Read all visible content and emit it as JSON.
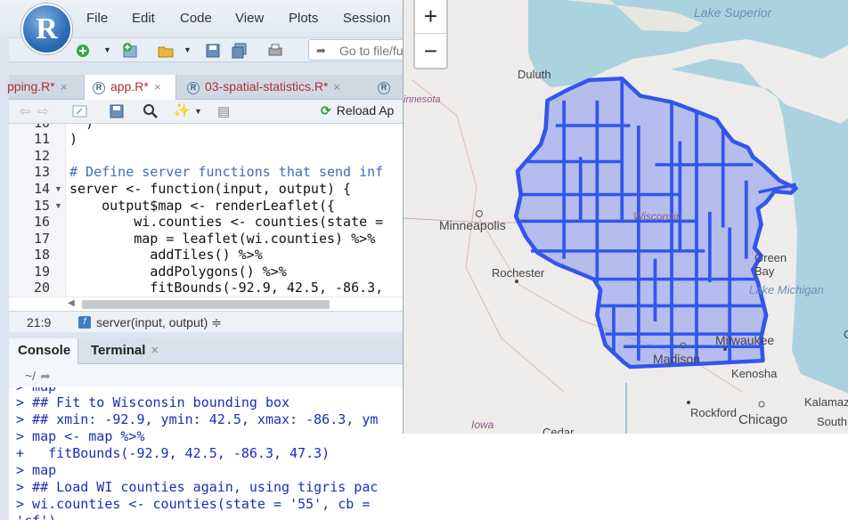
{
  "menu": {
    "logo": "R",
    "items": [
      "File",
      "Edit",
      "Code",
      "View",
      "Plots",
      "Session"
    ]
  },
  "toolbar": {
    "goto_placeholder": "Go to file/fu"
  },
  "editor": {
    "tabs": [
      {
        "label": "pping.R*",
        "active": false
      },
      {
        "label": "app.R*",
        "active": true
      },
      {
        "label": "03-spatial-statistics.R*",
        "active": false
      },
      {
        "label": "",
        "active": false
      }
    ],
    "reload_label": "Reload Ap",
    "lines": [
      {
        "n": "10",
        "text": "  )"
      },
      {
        "n": "11",
        "text": ")"
      },
      {
        "n": "12",
        "text": ""
      },
      {
        "n": "13",
        "text": "# Define server functions that send inf"
      },
      {
        "n": "14",
        "text": "server <- function(input, output) {"
      },
      {
        "n": "15",
        "text": "    output$map <- renderLeaflet({"
      },
      {
        "n": "16",
        "text": "        wi.counties <- counties(state ="
      },
      {
        "n": "17",
        "text": "        map = leaflet(wi.counties) %>%"
      },
      {
        "n": "18",
        "text": "          addTiles() %>%"
      },
      {
        "n": "19",
        "text": "          addPolygons() %>%"
      },
      {
        "n": "20",
        "text": "          fitBounds(-92.9, 42.5, -86.3,"
      },
      {
        "n": "21",
        "text": ""
      }
    ],
    "cursor_position": "21:9",
    "function_scope": "server(input, output) ≑"
  },
  "console": {
    "tabs": [
      "Console",
      "Terminal"
    ],
    "working_dir": "~/",
    "lines": [
      "> map",
      "> ## Fit to Wisconsin bounding box",
      "> ## xmin: -92.9, ymin: 42.5, xmax: -86.3, ym",
      "> map <- map %>%",
      "+   fitBounds(-92.9, 42.5, -86.3, 47.3)",
      "> map",
      "> ## Load WI counties again, using tigris pac",
      "> wi.counties <- counties(state = '55', cb =",
      "'cf')"
    ]
  },
  "map": {
    "zoom_in": "+",
    "zoom_out": "−",
    "labels": {
      "lake_superior": "Lake Superior",
      "duluth": "Duluth",
      "minnesota": "innesota",
      "minneapolis": "Minneapolis",
      "wisconsin": "Wisconsin",
      "rochester": "Rochester",
      "green_bay": "Green Bay",
      "lake_michigan": "Lake Michigan",
      "milwaukee": "Milwaukee",
      "madison": "Madison",
      "kenosha": "Kenosha",
      "rockford": "Rockford",
      "chicago": "Chicago",
      "iowa": "Iowa",
      "cedar": "Cedar",
      "kalamazoo": "Kalamaz",
      "south": "South",
      "edge_c": "C"
    },
    "polygon_color": "#3355ee"
  }
}
